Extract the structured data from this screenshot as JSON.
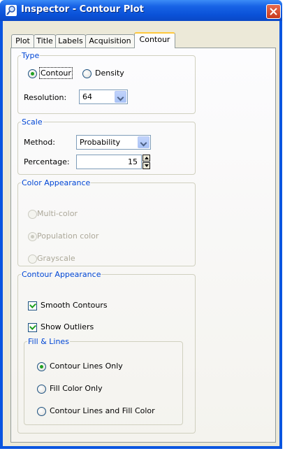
{
  "window": {
    "title": "Inspector - Contour Plot"
  },
  "tabs": [
    {
      "label": "Plot"
    },
    {
      "label": "Title"
    },
    {
      "label": "Labels"
    },
    {
      "label": "Acquisition"
    },
    {
      "label": "Contour",
      "active": true
    }
  ],
  "type_group": {
    "legend": "Type",
    "options": [
      {
        "label": "Contour",
        "selected": true
      },
      {
        "label": "Density",
        "selected": false
      }
    ],
    "resolution_label": "Resolution:",
    "resolution_value": "64"
  },
  "scale_group": {
    "legend": "Scale",
    "method_label": "Method:",
    "method_value": "Probability",
    "percentage_label": "Percentage:",
    "percentage_value": "15"
  },
  "color_group": {
    "legend": "Color Appearance",
    "options": [
      {
        "label": "Multi-color",
        "selected": false,
        "enabled": false
      },
      {
        "label": "Population color",
        "selected": true,
        "enabled": false
      },
      {
        "label": "Grayscale",
        "selected": false,
        "enabled": false
      }
    ]
  },
  "contour_group": {
    "legend": "Contour Appearance",
    "smooth_label": "Smooth Contours",
    "smooth_checked": true,
    "outliers_label": "Show Outliers",
    "outliers_checked": true,
    "fill_lines": {
      "legend": "Fill & Lines",
      "options": [
        {
          "label": "Contour Lines Only",
          "selected": true
        },
        {
          "label": "Fill Color Only",
          "selected": false
        },
        {
          "label": "Contour Lines and Fill Color",
          "selected": false
        }
      ]
    }
  },
  "colors": {
    "titlebar": "#0a55e0",
    "group_legend": "#0046d5",
    "radio_dot": "#21a121",
    "active_tab_highlight": "#ffc83c",
    "close_button": "#c7381c"
  }
}
